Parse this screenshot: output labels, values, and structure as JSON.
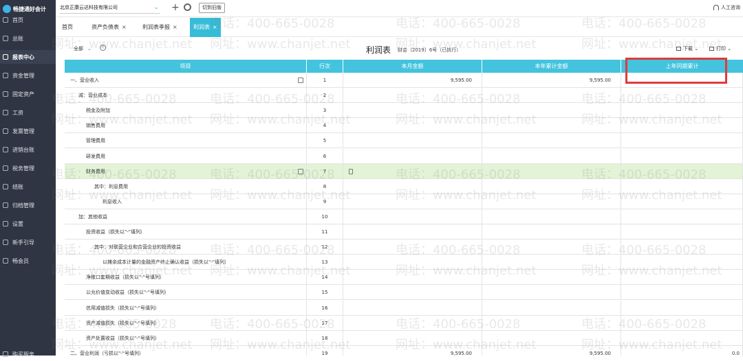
{
  "app": {
    "name": "畅捷通好会计"
  },
  "sidebar": {
    "items": [
      {
        "label": "首页",
        "icon": "home-icon"
      },
      {
        "label": "总账",
        "icon": "ledger-icon"
      },
      {
        "label": "报表中心",
        "icon": "report-icon",
        "active": true
      },
      {
        "label": "资金管理",
        "icon": "wallet-icon"
      },
      {
        "label": "固定资产",
        "icon": "asset-icon"
      },
      {
        "label": "工资",
        "icon": "salary-icon"
      },
      {
        "label": "发票管理",
        "icon": "invoice-icon"
      },
      {
        "label": "进销台账",
        "icon": "inventory-icon"
      },
      {
        "label": "税务管理",
        "icon": "tax-icon"
      },
      {
        "label": "结账",
        "icon": "close-books-icon"
      },
      {
        "label": "归档管理",
        "icon": "archive-icon"
      },
      {
        "label": "设置",
        "icon": "gear-icon"
      },
      {
        "label": "新手引导",
        "icon": "guide-icon"
      },
      {
        "label": "畅会员",
        "icon": "member-icon"
      }
    ],
    "footer": "购买服务"
  },
  "topbar": {
    "company": "北京正康云达科技有限公司",
    "switch_label": "切到旧版",
    "help_label": "人工咨询"
  },
  "tabs": [
    {
      "label": "首页",
      "closable": false
    },
    {
      "label": "资产负债表",
      "closable": true
    },
    {
      "label": "利润表季报",
      "closable": true
    },
    {
      "label": "利润表",
      "closable": true,
      "active": true
    }
  ],
  "toolbar": {
    "period": "全部",
    "title": "利润表",
    "subtitle": "财会〔2019〕6号（已执行）",
    "download": "下载",
    "print": "打印"
  },
  "table": {
    "headers": [
      "项目",
      "行次",
      "本月金额",
      "本年累计金额",
      "上年同期累计"
    ],
    "rows": [
      {
        "item": "一、营业收入",
        "no": "1",
        "m1": "9,595.00",
        "m2": "9,595.00",
        "m3": "",
        "indent": 0,
        "edit": true
      },
      {
        "item": "减：营业成本",
        "no": "2",
        "m1": "",
        "m2": "",
        "m3": "",
        "indent": 1
      },
      {
        "item": "税金及附加",
        "no": "3",
        "m1": "",
        "m2": "",
        "m3": "",
        "indent": 2
      },
      {
        "item": "销售费用",
        "no": "4",
        "m1": "",
        "m2": "",
        "m3": "",
        "indent": 2
      },
      {
        "item": "管理费用",
        "no": "5",
        "m1": "",
        "m2": "",
        "m3": "",
        "indent": 2
      },
      {
        "item": "研发费用",
        "no": "6",
        "m1": "",
        "m2": "",
        "m3": "",
        "indent": 2
      },
      {
        "item": "财务费用",
        "no": "7",
        "m1": "",
        "m2": "",
        "m3": "",
        "indent": 2,
        "edit": true,
        "highlight": true
      },
      {
        "item": "其中：利息费用",
        "no": "8",
        "m1": "",
        "m2": "",
        "m3": "",
        "indent": 3
      },
      {
        "item": "利息收入",
        "no": "9",
        "m1": "",
        "m2": "",
        "m3": "",
        "indent": 4
      },
      {
        "item": "加：其他收益",
        "no": "10",
        "m1": "",
        "m2": "",
        "m3": "",
        "indent": 1
      },
      {
        "item": "投资收益（损失以\"-\"填列）",
        "no": "11",
        "m1": "",
        "m2": "",
        "m3": "",
        "indent": 2
      },
      {
        "item": "其中：对联营企业和合营企业的投资收益",
        "no": "12",
        "m1": "",
        "m2": "",
        "m3": "",
        "indent": 3
      },
      {
        "item": "以摊余成本计量的金融资产终止确认收益（损失以\"-\"填列）",
        "no": "13",
        "m1": "",
        "m2": "",
        "m3": "",
        "indent": 4
      },
      {
        "item": "净敞口套期收益（损失以\"-\"号填列）",
        "no": "14",
        "m1": "",
        "m2": "",
        "m3": "",
        "indent": 2
      },
      {
        "item": "公允价值变动收益（损失以\"-\"号填列）",
        "no": "15",
        "m1": "",
        "m2": "",
        "m3": "",
        "indent": 2
      },
      {
        "item": "信用减值损失（损失以\"-\"号填列）",
        "no": "16",
        "m1": "",
        "m2": "",
        "m3": "",
        "indent": 2
      },
      {
        "item": "资产减值损失（损失以\"-\"号填列）",
        "no": "17",
        "m1": "",
        "m2": "",
        "m3": "",
        "indent": 2
      },
      {
        "item": "资产处置收益（损失以\"-\"号填列）",
        "no": "18",
        "m1": "",
        "m2": "",
        "m3": "",
        "indent": 2
      },
      {
        "item": "二、营业利润（亏损以\"-\"号填列）",
        "no": "19",
        "m1": "9,595.00",
        "m2": "9,595.00",
        "m3": "0.0",
        "indent": 0
      }
    ]
  },
  "watermark": {
    "phone": "电话：400-665-0028",
    "site": "网址：www.chanjet.net"
  },
  "colors": {
    "accent": "#37bcd8",
    "header": "#43c3dd",
    "sidebar": "#2f3542",
    "highlight_row": "#e3f3d6",
    "annotation": "#e03a3a"
  }
}
